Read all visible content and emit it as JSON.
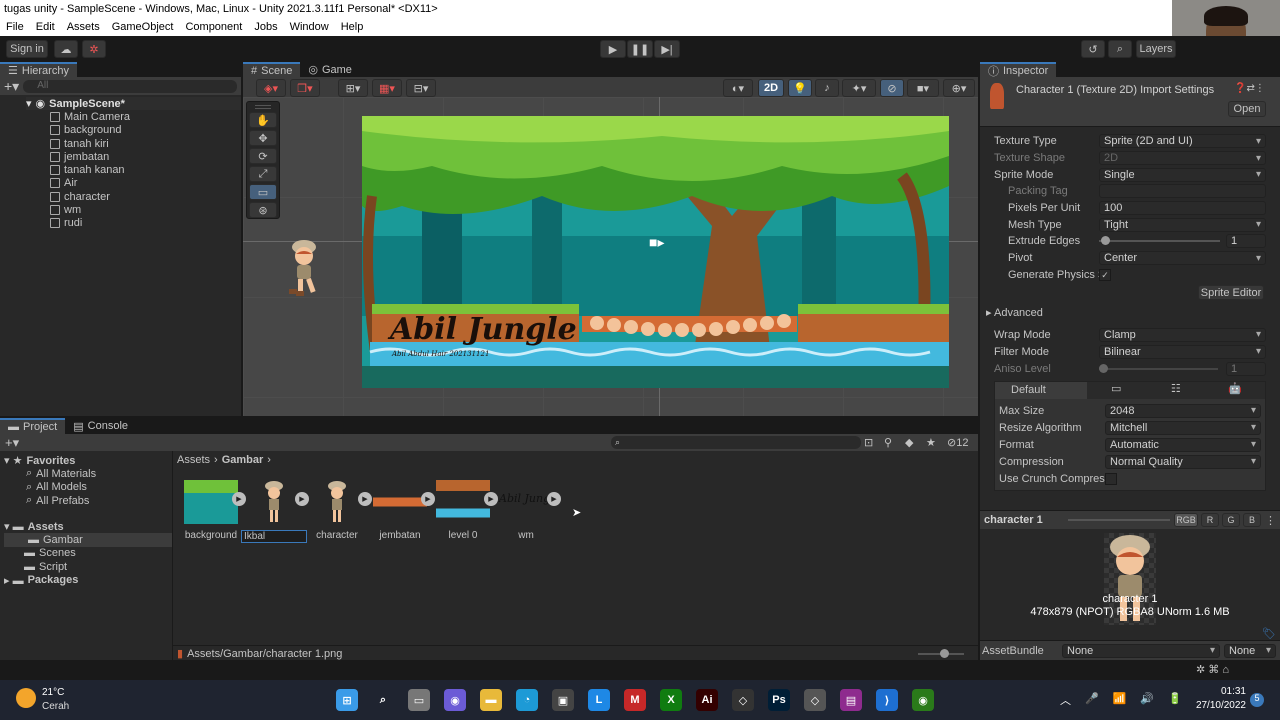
{
  "window": {
    "title": "tugas unity - SampleScene - Windows, Mac, Linux - Unity 2021.3.11f1 Personal* <DX11>"
  },
  "menu": [
    "File",
    "Edit",
    "Assets",
    "GameObject",
    "Component",
    "Jobs",
    "Window",
    "Help"
  ],
  "toolbar": {
    "sign_in": "Sign in",
    "layers": "Layers"
  },
  "hierarchy": {
    "tab": "Hierarchy",
    "search_placeholder": "All",
    "scene": "SampleScene*",
    "items": [
      "Main Camera",
      "background",
      "tanah kiri",
      "jembatan",
      "tanah kanan",
      "Air",
      "character",
      "wm",
      "rudi"
    ]
  },
  "scene_view": {
    "tab_scene": "Scene",
    "tab_game": "Game",
    "mode_2d": "2D",
    "logo_title": "Abil Jungle",
    "logo_sub": "Abil Abdul Hair 202131121"
  },
  "inspector": {
    "tab": "Inspector",
    "header": "Character 1 (Texture 2D) Import Settings",
    "open": "Open",
    "rows": [
      {
        "label": "Texture Type",
        "value": "Sprite (2D and UI)",
        "dim": false
      },
      {
        "label": "Texture Shape",
        "value": "2D",
        "dim": true
      },
      {
        "label": "Sprite Mode",
        "value": "Single",
        "dim": false
      },
      {
        "label": "Packing Tag",
        "value": "",
        "dim": true
      },
      {
        "label": "Pixels Per Unit",
        "value": "100",
        "dim": false
      },
      {
        "label": "Mesh Type",
        "value": "Tight",
        "dim": false
      },
      {
        "label": "Extrude Edges",
        "value": "1",
        "dim": false
      },
      {
        "label": "Pivot",
        "value": "Center",
        "dim": false
      },
      {
        "label": "Generate Physics Shape",
        "value": "✓",
        "dim": false
      }
    ],
    "sprite_editor": "Sprite Editor",
    "advanced": "Advanced",
    "wrap_mode": {
      "label": "Wrap Mode",
      "value": "Clamp"
    },
    "filter_mode": {
      "label": "Filter Mode",
      "value": "Bilinear"
    },
    "aniso": {
      "label": "Aniso Level",
      "value": "1"
    },
    "platform_tab": "Default",
    "max_size": {
      "label": "Max Size",
      "value": "2048"
    },
    "resize": {
      "label": "Resize Algorithm",
      "value": "Mitchell"
    },
    "format": {
      "label": "Format",
      "value": "Automatic"
    },
    "compression": {
      "label": "Compression",
      "value": "Normal Quality"
    },
    "crunch": {
      "label": "Use Crunch Compression"
    },
    "preview": {
      "name": "character 1",
      "channels": [
        "RGB",
        "R",
        "G",
        "B"
      ],
      "caption": "character 1",
      "info": "478x879 (NPOT)  RGBA8 UNorm   1.6 MB"
    },
    "asset_bundle": {
      "label": "AssetBundle",
      "value": "None",
      "variant": "None"
    }
  },
  "project": {
    "tab_project": "Project",
    "tab_console": "Console",
    "favorites": "Favorites",
    "fav_items": [
      "All Materials",
      "All Models",
      "All Prefabs"
    ],
    "assets": "Assets",
    "asset_folders": [
      "Gambar",
      "Scenes",
      "Script"
    ],
    "packages": "Packages",
    "breadcrumb": [
      "Assets",
      "Gambar"
    ],
    "hidden_count": "12",
    "files": [
      "background",
      "Ikbal",
      "character",
      "jembatan",
      "level 0",
      "wm"
    ],
    "status_path": "Assets/Gambar/character 1.png"
  },
  "taskbar": {
    "temp": "21°C",
    "weather": "Cerah",
    "time": "01:31",
    "date": "27/10/2022",
    "badge": "5"
  },
  "colors": {
    "accent": "#3a79bb",
    "panel": "#282828",
    "header": "#191919"
  }
}
